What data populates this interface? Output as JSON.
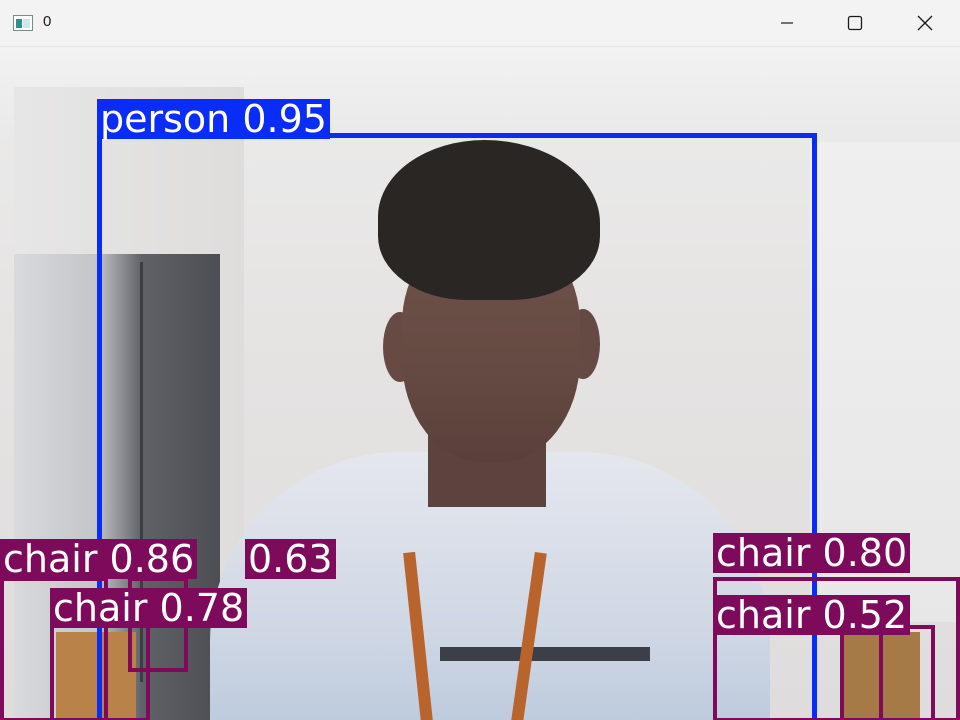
{
  "window": {
    "title": "0",
    "icon": "app-window-icon",
    "controls": {
      "minimize_icon": "minimize-icon",
      "maximize_icon": "maximize-icon",
      "close_icon": "close-icon"
    }
  },
  "colors": {
    "person_box": "#0a2cf7",
    "chair_box": "#7e0a5c",
    "label_text": "#ffffff"
  },
  "detections": {
    "person": {
      "label": "person 0.95"
    },
    "chair_a": {
      "label": "chair 0.86"
    },
    "chair_b": {
      "label": "0.63"
    },
    "chair_c": {
      "label": "chair 0.78"
    },
    "chair_d": {
      "label": "chair 0.80"
    },
    "chair_e": {
      "label": "chair 0.52"
    }
  }
}
